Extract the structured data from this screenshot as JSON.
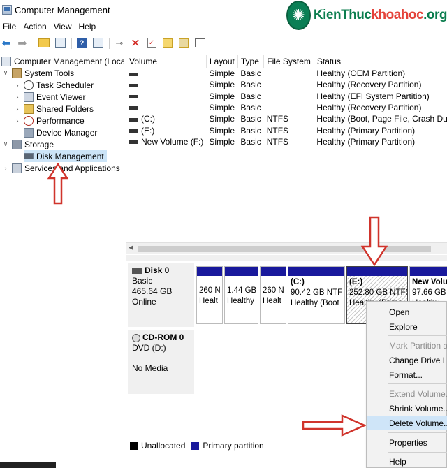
{
  "window": {
    "title": "Computer Management"
  },
  "logo": {
    "brand_kien": "KienThuc",
    "brand_khoa": "khoahoc",
    "brand_tld": ".org"
  },
  "menu": [
    "File",
    "Action",
    "View",
    "Help"
  ],
  "tree": {
    "root": "Computer Management (Local",
    "system_tools": "System Tools",
    "task_scheduler": "Task Scheduler",
    "event_viewer": "Event Viewer",
    "shared_folders": "Shared Folders",
    "performance": "Performance",
    "device_manager": "Device Manager",
    "storage": "Storage",
    "disk_management": "Disk Management",
    "services": "Services and Applications"
  },
  "volumes": {
    "headers": [
      "Volume",
      "Layout",
      "Type",
      "File System",
      "Status"
    ],
    "rows": [
      {
        "volume": "",
        "layout": "Simple",
        "type": "Basic",
        "fs": "",
        "status": "Healthy (OEM Partition)"
      },
      {
        "volume": "",
        "layout": "Simple",
        "type": "Basic",
        "fs": "",
        "status": "Healthy (Recovery Partition)"
      },
      {
        "volume": "",
        "layout": "Simple",
        "type": "Basic",
        "fs": "",
        "status": "Healthy (EFI System Partition)"
      },
      {
        "volume": "",
        "layout": "Simple",
        "type": "Basic",
        "fs": "",
        "status": "Healthy (Recovery Partition)"
      },
      {
        "volume": "(C:)",
        "layout": "Simple",
        "type": "Basic",
        "fs": "NTFS",
        "status": "Healthy (Boot, Page File, Crash Dump, H"
      },
      {
        "volume": "(E:)",
        "layout": "Simple",
        "type": "Basic",
        "fs": "NTFS",
        "status": "Healthy (Primary Partition)"
      },
      {
        "volume": "New Volume (F:)",
        "layout": "Simple",
        "type": "Basic",
        "fs": "NTFS",
        "status": "Healthy (Primary Partition)"
      }
    ]
  },
  "disk0": {
    "name": "Disk 0",
    "type": "Basic",
    "size": "465.64 GB",
    "state": "Online",
    "partitions": [
      {
        "name": "",
        "line1": "260 N",
        "line2": "Healt"
      },
      {
        "name": "",
        "line1": "1.44 GB",
        "line2": "Healthy"
      },
      {
        "name": "",
        "line1": "260 N",
        "line2": "Healt"
      },
      {
        "name": "(C:)",
        "line1": "90.42 GB NTF",
        "line2": "Healthy (Boot"
      },
      {
        "name": "(E:)",
        "line1": "252.80 GB NTFS",
        "line2": "Healthy (Prima"
      },
      {
        "name": "New Volu",
        "line1": "97.66 GB",
        "line2": "Healthy"
      }
    ]
  },
  "cdrom": {
    "name": "CD-ROM 0",
    "type": "DVD (D:)",
    "state": "No Media"
  },
  "legend": {
    "unallocated": "Unallocated",
    "primary": "Primary partition"
  },
  "context_menu": {
    "open": "Open",
    "explore": "Explore",
    "mark_active": "Mark Partition as",
    "change_letter": "Change Drive Let",
    "format": "Format...",
    "extend": "Extend Volume...",
    "shrink": "Shrink Volume...",
    "delete": "Delete Volume...",
    "properties": "Properties",
    "help": "Help"
  },
  "colors": {
    "primary_partition": "#19199c",
    "unallocated": "#000000",
    "arrow": "#d0342c",
    "selection": "#cce4f7"
  }
}
